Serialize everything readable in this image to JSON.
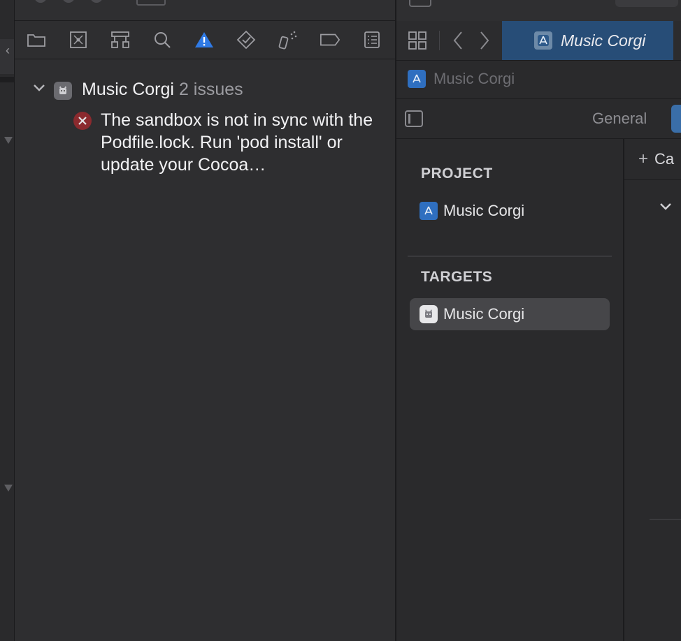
{
  "navigator": {
    "toolbar": {
      "icons": [
        "folder-icon",
        "source-control-icon",
        "hierarchy-icon",
        "search-icon",
        "warning-icon",
        "test-icon",
        "debug-icon",
        "breakpoint-icon",
        "report-icon"
      ],
      "active": "warning-icon",
      "active_color": "#2f7ae5"
    },
    "issues": {
      "project_name": "Music Corgi",
      "issue_count": "2 issues",
      "error_message": "The sandbox is not in sync with the Podfile.lock. Run 'pod install' or update your Cocoa…",
      "error_color": "#c0383e"
    }
  },
  "editor": {
    "tab_title": "Music Corgi",
    "jump_bar_label": "Music Corgi",
    "settings_tabs": {
      "general": "General"
    },
    "sidebar": {
      "project_header": "PROJECT",
      "project_item": "Music Corgi",
      "targets_header": "TARGETS",
      "target_item": "Music Corgi"
    },
    "content": {
      "add_capability_label": "Ca"
    }
  }
}
